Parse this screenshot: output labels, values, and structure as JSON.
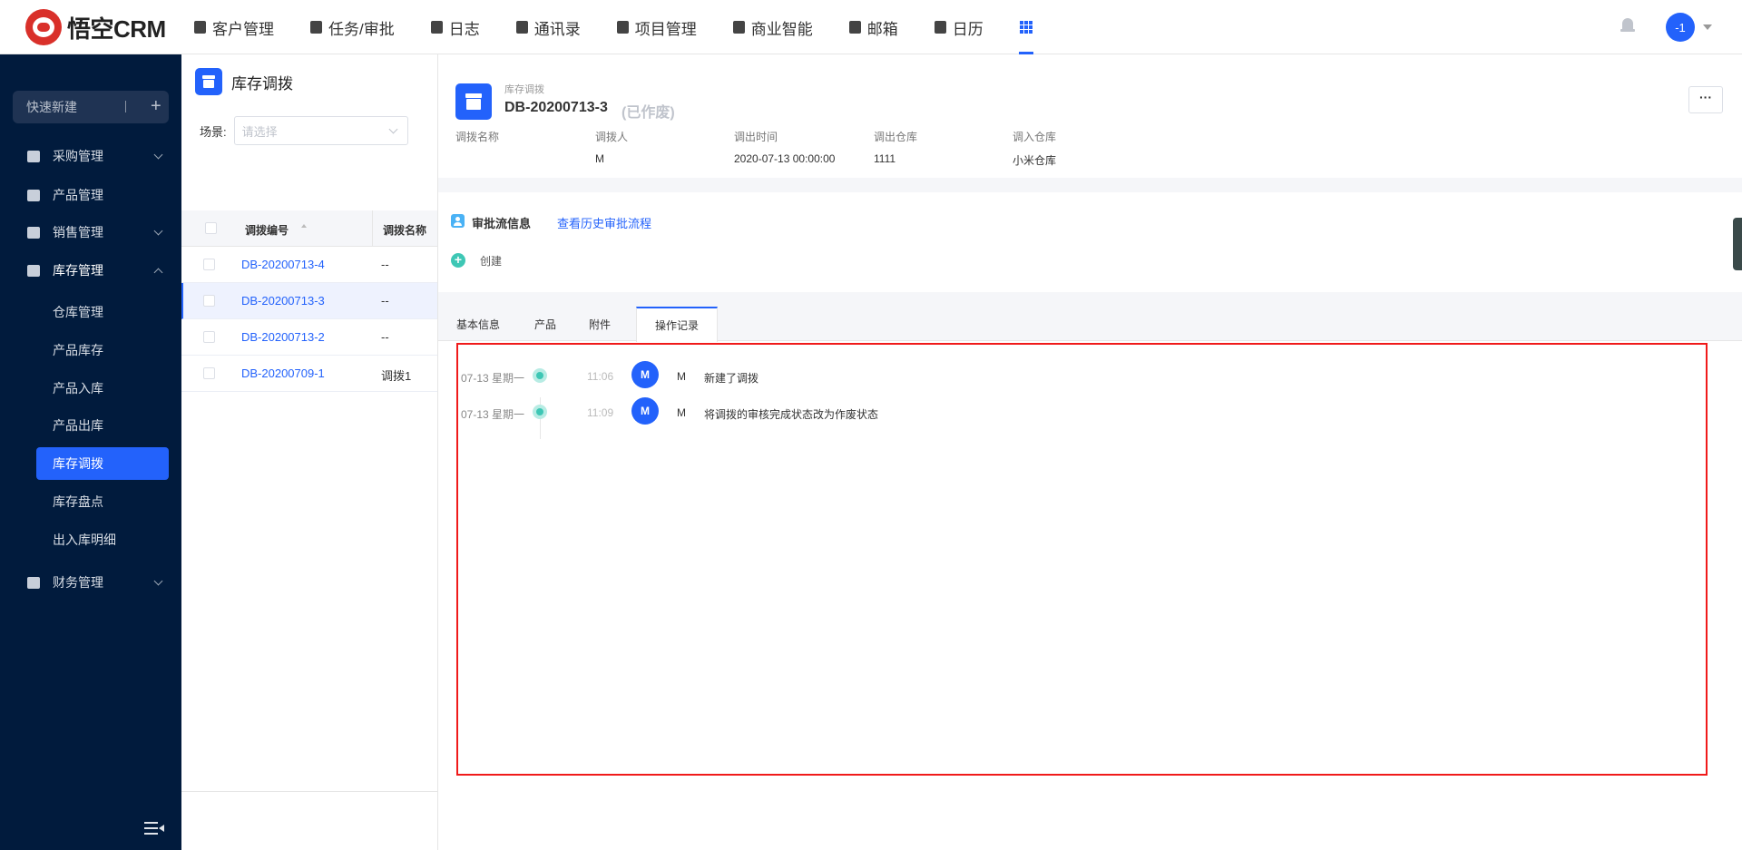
{
  "app": {
    "logo_text": "悟空CRM"
  },
  "topnav": [
    {
      "label": "客户管理",
      "icon": "customer-icon"
    },
    {
      "label": "任务/审批",
      "icon": "briefcase-icon"
    },
    {
      "label": "日志",
      "icon": "log-icon"
    },
    {
      "label": "通讯录",
      "icon": "phone-book-icon"
    },
    {
      "label": "项目管理",
      "icon": "project-icon"
    },
    {
      "label": "商业智能",
      "icon": "bi-icon"
    },
    {
      "label": "邮箱",
      "icon": "mail-icon"
    },
    {
      "label": "日历",
      "icon": "calendar-icon"
    }
  ],
  "user": {
    "avatar_text": "-1"
  },
  "sidebar": {
    "quick_create": "快速新建",
    "quick_plus": "+",
    "groups": [
      {
        "label": "采购管理"
      },
      {
        "label": "产品管理"
      },
      {
        "label": "销售管理"
      },
      {
        "label": "库存管理"
      },
      {
        "label": "财务管理"
      }
    ],
    "inventory_items": [
      {
        "label": "仓库管理"
      },
      {
        "label": "产品库存"
      },
      {
        "label": "产品入库"
      },
      {
        "label": "产品出库"
      },
      {
        "label": "库存调拨"
      },
      {
        "label": "库存盘点"
      },
      {
        "label": "出入库明细"
      }
    ]
  },
  "list": {
    "title": "库存调拨",
    "scene_label": "场景:",
    "scene_placeholder": "请选择",
    "columns": [
      "调拨编号",
      "调拨名称"
    ],
    "rows": [
      {
        "code": "DB-20200713-4",
        "name": "--"
      },
      {
        "code": "DB-20200713-3",
        "name": "--"
      },
      {
        "code": "DB-20200713-2",
        "name": "--"
      },
      {
        "code": "DB-20200709-1",
        "name": "调拨1"
      }
    ]
  },
  "detail": {
    "type_label": "库存调拨",
    "title": "DB-20200713-3",
    "status": "(已作废)",
    "more": "···",
    "fields": [
      {
        "key": "调拨名称",
        "value": ""
      },
      {
        "key": "调拨人",
        "value": "M"
      },
      {
        "key": "调出时间",
        "value": "2020-07-13 00:00:00"
      },
      {
        "key": "调出仓库",
        "value": "1111"
      },
      {
        "key": "调入仓库",
        "value": "小米仓库"
      }
    ],
    "approval": {
      "title": "审批流信息",
      "history_link": "查看历史审批流程",
      "step": "创建"
    },
    "tabs": [
      "基本信息",
      "产品",
      "附件",
      "操作记录"
    ],
    "logs": [
      {
        "date": "07-13 星期一",
        "time": "11:06",
        "avatar": "M",
        "user": "M",
        "action": "新建了调拨"
      },
      {
        "date": "07-13 星期一",
        "time": "11:09",
        "avatar": "M",
        "user": "M",
        "action": "将调拨的审核完成状态改为作废状态"
      }
    ]
  },
  "colors": {
    "accent": "#2362fb",
    "sidebar_bg": "#011b3d",
    "highlight_box": "#f01a1a",
    "timeline": "#3ec7b5"
  }
}
